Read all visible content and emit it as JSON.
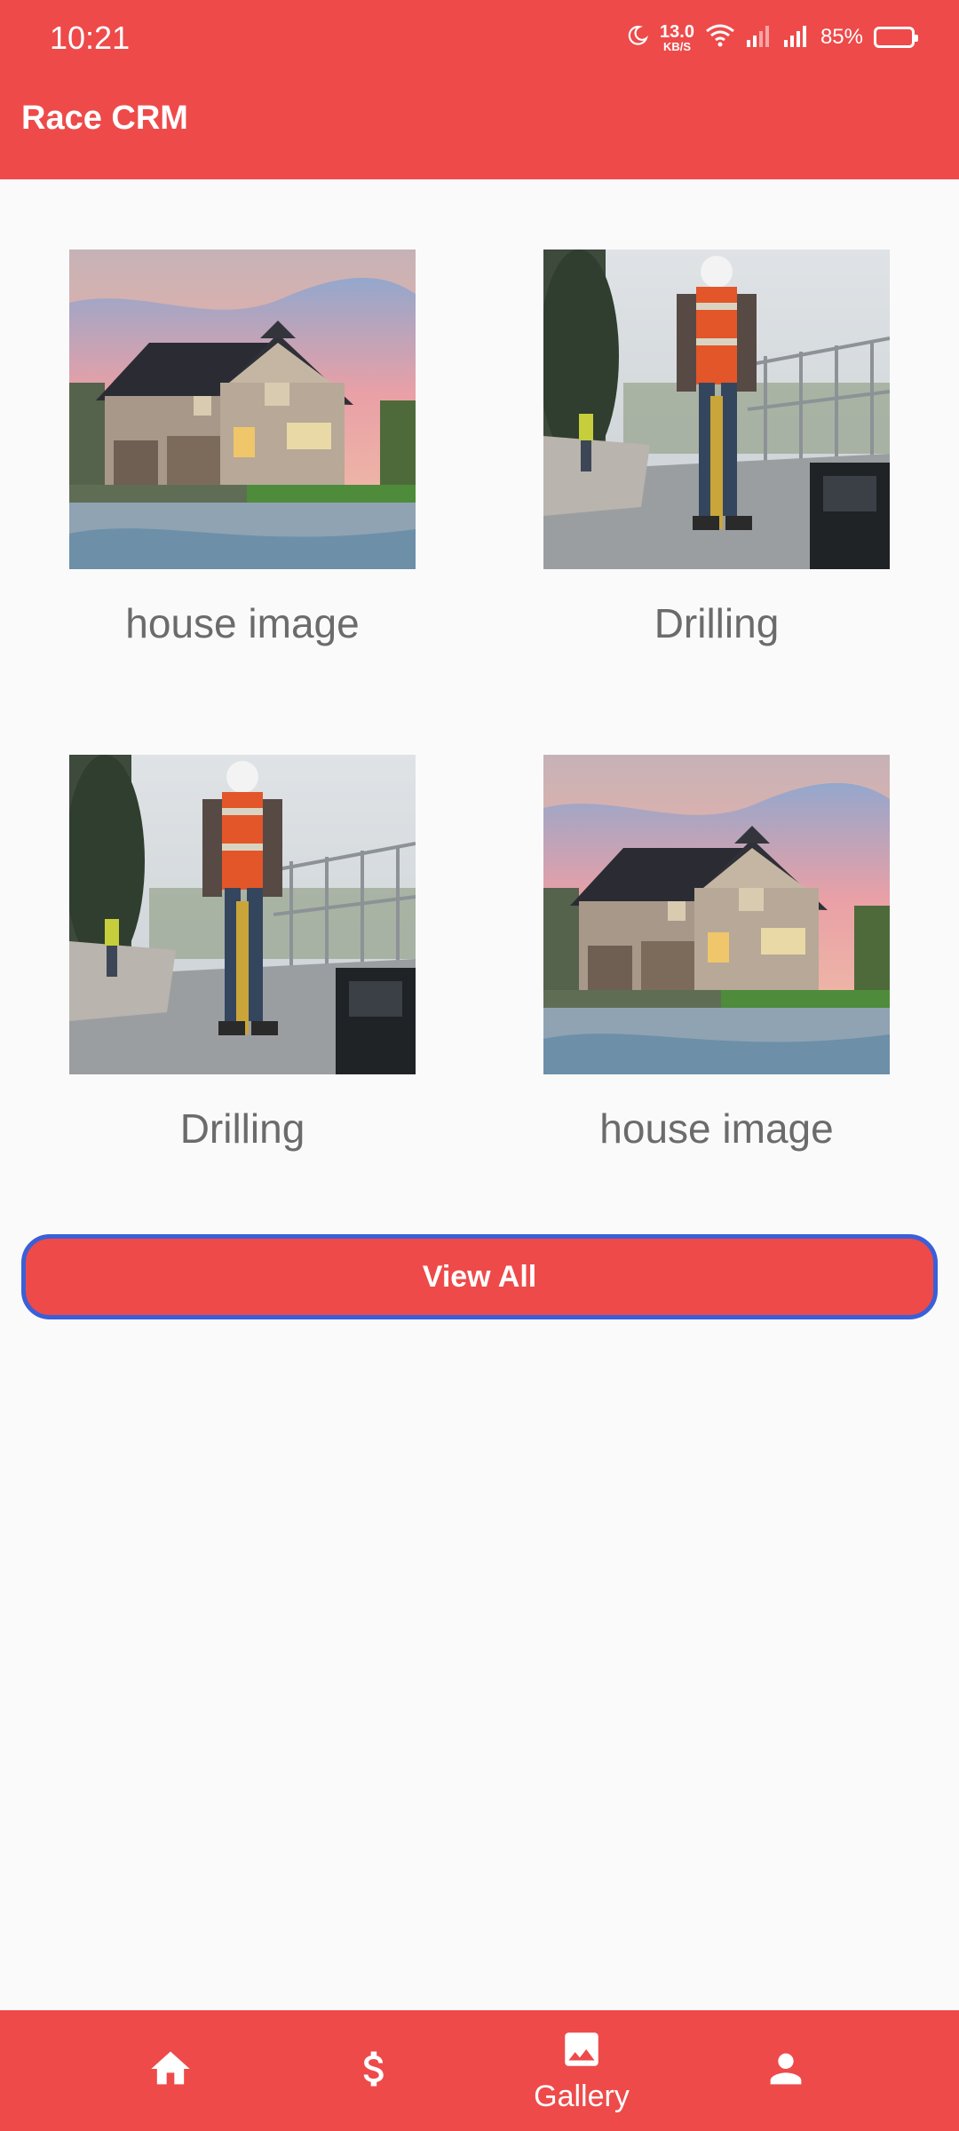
{
  "status_bar": {
    "time": "10:21",
    "net_speed_value": "13.0",
    "net_speed_unit": "KB/S",
    "battery_percent": "85%"
  },
  "app": {
    "title": "Race CRM"
  },
  "gallery": {
    "items": [
      {
        "caption": "house image",
        "image": "house-photo"
      },
      {
        "caption": "Drilling",
        "image": "worker-drilling-photo"
      },
      {
        "caption": "Drilling",
        "image": "worker-drilling-photo"
      },
      {
        "caption": "house image",
        "image": "house-photo"
      }
    ],
    "view_all_label": "View All"
  },
  "bottom_nav": {
    "items": [
      {
        "icon": "home-icon",
        "label": ""
      },
      {
        "icon": "dollar-icon",
        "label": ""
      },
      {
        "icon": "image-icon",
        "label": "Gallery"
      },
      {
        "icon": "person-icon",
        "label": ""
      }
    ]
  },
  "colors": {
    "primary": "#ee4a4a",
    "button_border": "#3a5fd8",
    "caption_text": "#6b6b6b",
    "background": "#fafafa"
  }
}
